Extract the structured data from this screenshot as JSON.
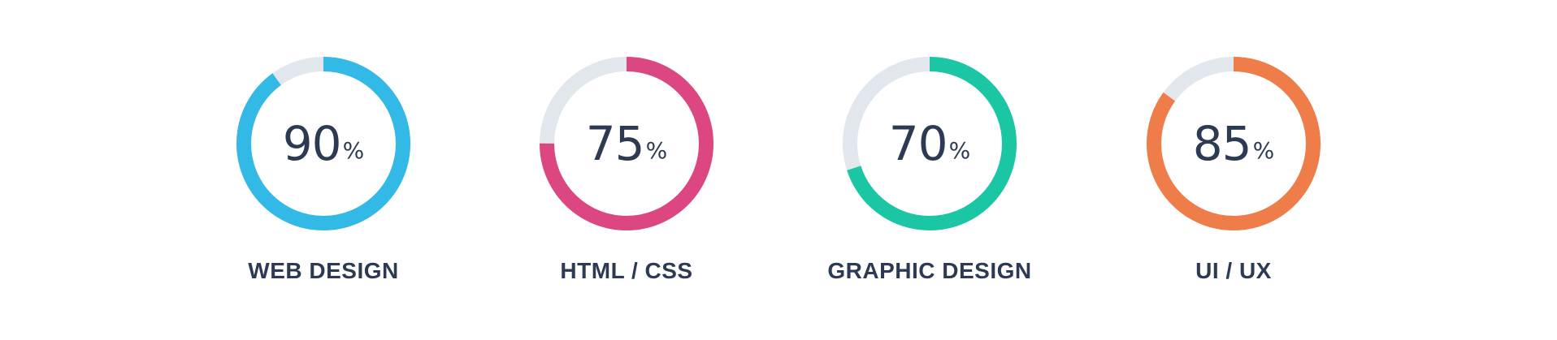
{
  "track_color": "#e1e7ec",
  "text_color": "#2d3a54",
  "skills": [
    {
      "label": "WEB DESIGN",
      "value": "90",
      "unit": "%",
      "percent": 90,
      "color": "#32b9e6"
    },
    {
      "label": "HTML / CSS",
      "value": "75",
      "unit": "%",
      "percent": 75,
      "color": "#dc4681"
    },
    {
      "label": "GRAPHIC DESIGN",
      "value": "70",
      "unit": "%",
      "percent": 70,
      "color": "#1bc6a5"
    },
    {
      "label": "UI / UX",
      "value": "85",
      "unit": "%",
      "percent": 85,
      "color": "#ee7d49"
    }
  ]
}
